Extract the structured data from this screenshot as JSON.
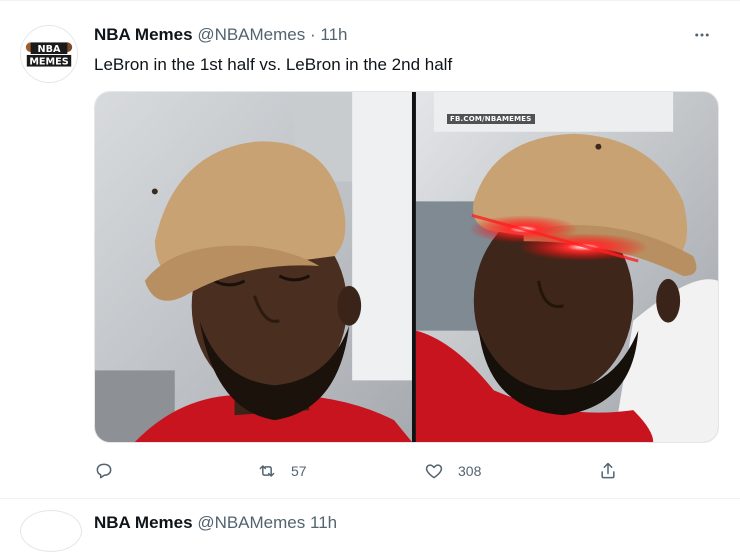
{
  "tweet": {
    "avatar_logo": {
      "line1": "NBA",
      "line2": "MEMES"
    },
    "display_name": "NBA Memes",
    "handle": "@NBAMemes",
    "separator": "·",
    "time": "11h",
    "text": "LeBron in the 1st half vs. LeBron in the 2nd half",
    "media": {
      "watermark": "FB.COM/NBAMEMES",
      "panels": [
        "sleeping-man-left-panel",
        "glowing-eyes-man-right-panel"
      ]
    },
    "actions": {
      "reply": {
        "icon": "reply-icon",
        "count": ""
      },
      "retweet": {
        "icon": "retweet-icon",
        "count": "57"
      },
      "like": {
        "icon": "heart-icon",
        "count": "308"
      },
      "share": {
        "icon": "share-icon",
        "count": ""
      }
    }
  },
  "next_tweet": {
    "display_name": "NBA Memes",
    "handle": "@NBAMemes",
    "time": "11h"
  },
  "colors": {
    "text_primary": "#0f1419",
    "text_secondary": "#536471",
    "border": "#eff3f4",
    "shirt_red": "#c8141e",
    "cap_tan": "#c9a273",
    "laser_red": "#ff1a1a"
  }
}
